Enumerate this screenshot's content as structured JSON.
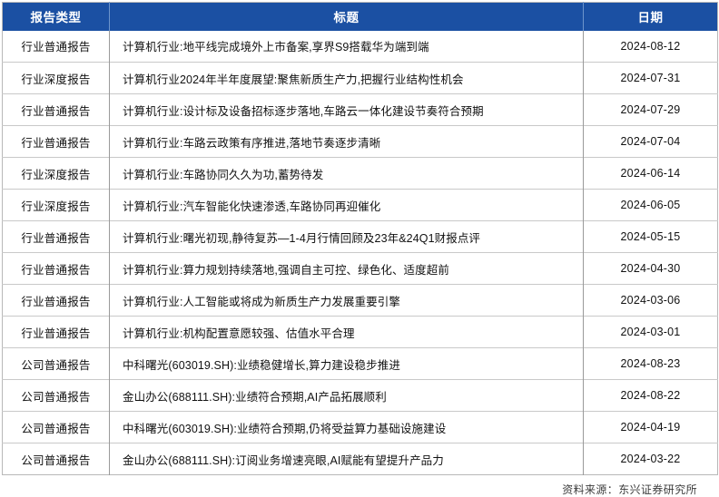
{
  "table": {
    "columns": [
      {
        "key": "type",
        "label": "报告类型"
      },
      {
        "key": "title",
        "label": "标题"
      },
      {
        "key": "date",
        "label": "日期"
      }
    ],
    "header_bg": "#1B50A3",
    "header_text_color": "#FFFFFF",
    "rows": [
      {
        "type": "行业普通报告",
        "title": "计算机行业:地平线完成境外上市备案,享界S9搭载华为端到端",
        "date": "2024-08-12"
      },
      {
        "type": "行业深度报告",
        "title": "计算机行业2024年半年度展望:聚焦新质生产力,把握行业结构性机会",
        "date": "2024-07-31"
      },
      {
        "type": "行业普通报告",
        "title": "计算机行业:设计标及设备招标逐步落地,车路云一体化建设节奏符合预期",
        "date": "2024-07-29"
      },
      {
        "type": "行业普通报告",
        "title": "计算机行业:车路云政策有序推进,落地节奏逐步清晰",
        "date": "2024-07-04"
      },
      {
        "type": "行业深度报告",
        "title": "计算机行业:车路协同久久为功,蓄势待发",
        "date": "2024-06-14"
      },
      {
        "type": "行业深度报告",
        "title": "计算机行业:汽车智能化快速渗透,车路协同再迎催化",
        "date": "2024-06-05"
      },
      {
        "type": "行业普通报告",
        "title": "计算机行业:曙光初现,静待复苏—1-4月行情回顾及23年&24Q1财报点评",
        "date": "2024-05-15"
      },
      {
        "type": "行业普通报告",
        "title": "计算机行业:算力规划持续落地,强调自主可控、绿色化、适度超前",
        "date": "2024-04-30"
      },
      {
        "type": "行业普通报告",
        "title": "计算机行业:人工智能或将成为新质生产力发展重要引擎",
        "date": "2024-03-06"
      },
      {
        "type": "行业普通报告",
        "title": "计算机行业:机构配置意愿较强、估值水平合理",
        "date": "2024-03-01"
      },
      {
        "type": "公司普通报告",
        "title": "中科曙光(603019.SH):业绩稳健增长,算力建设稳步推进",
        "date": "2024-08-23"
      },
      {
        "type": "公司普通报告",
        "title": "金山办公(688111.SH):业绩符合预期,AI产品拓展顺利",
        "date": "2024-08-22"
      },
      {
        "type": "公司普通报告",
        "title": "中科曙光(603019.SH):业绩符合预期,仍将受益算力基础设施建设",
        "date": "2024-04-19"
      },
      {
        "type": "公司普通报告",
        "title": "金山办公(688111.SH):订阅业务增速亮眼,AI赋能有望提升产品力",
        "date": "2024-03-22"
      }
    ]
  },
  "footer": {
    "source_note": "资料来源：东兴证券研究所"
  }
}
